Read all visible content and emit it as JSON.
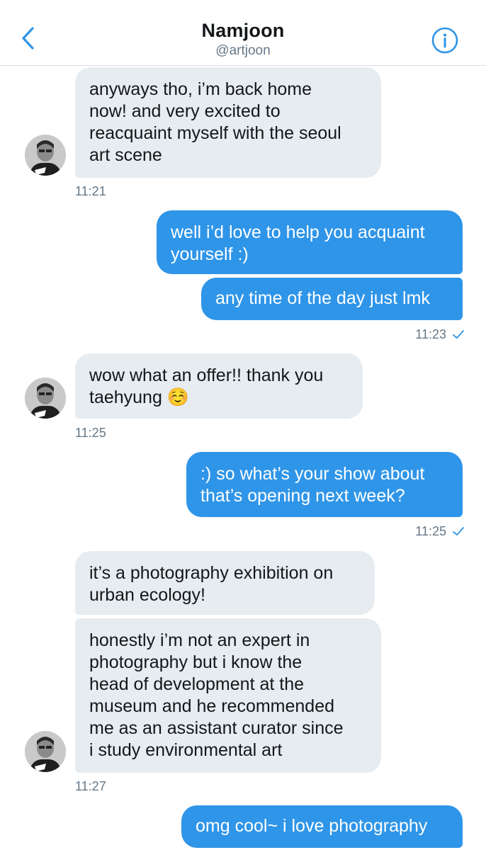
{
  "header": {
    "name": "Namjoon",
    "handle": "@artjoon"
  },
  "icons": {
    "back": "chevron-left-icon",
    "info": "info-circle-icon",
    "read": "checkmark-icon"
  },
  "colors": {
    "accent": "#1da1f2",
    "incoming_bubble": "#e6ecf0",
    "outgoing_bubble": "#2f95e8",
    "timestamp": "#657786"
  },
  "messages": [
    {
      "from": "them",
      "text": "anyways tho, i’m back home\nnow! and very excited to\nreacquaint myself with the seoul\nart scene"
    },
    {
      "from": "them",
      "time": "11:21"
    },
    {
      "from": "me",
      "text": "well i’d love to help you acquaint\nyourself :)"
    },
    {
      "from": "me",
      "text": "any time of the day just lmk"
    },
    {
      "from": "me",
      "time": "11:23"
    },
    {
      "from": "them",
      "text": "wow what an offer!! thank you\ntaehyung ☺️"
    },
    {
      "from": "them",
      "time": "11:25"
    },
    {
      "from": "me",
      "text": ":) so what’s your show about\nthat’s opening next week?"
    },
    {
      "from": "me",
      "time": "11:25"
    },
    {
      "from": "them",
      "text": "it’s a photography exhibition on\nurban ecology!"
    },
    {
      "from": "them",
      "text": "honestly i’m not an expert in\nphotography but i know the\nhead of development at the\nmuseum and he recommended\nme as an assistant curator since\ni study environmental art"
    },
    {
      "from": "them",
      "time": "11:27"
    },
    {
      "from": "me",
      "text": "omg cool~ i love photography"
    }
  ]
}
